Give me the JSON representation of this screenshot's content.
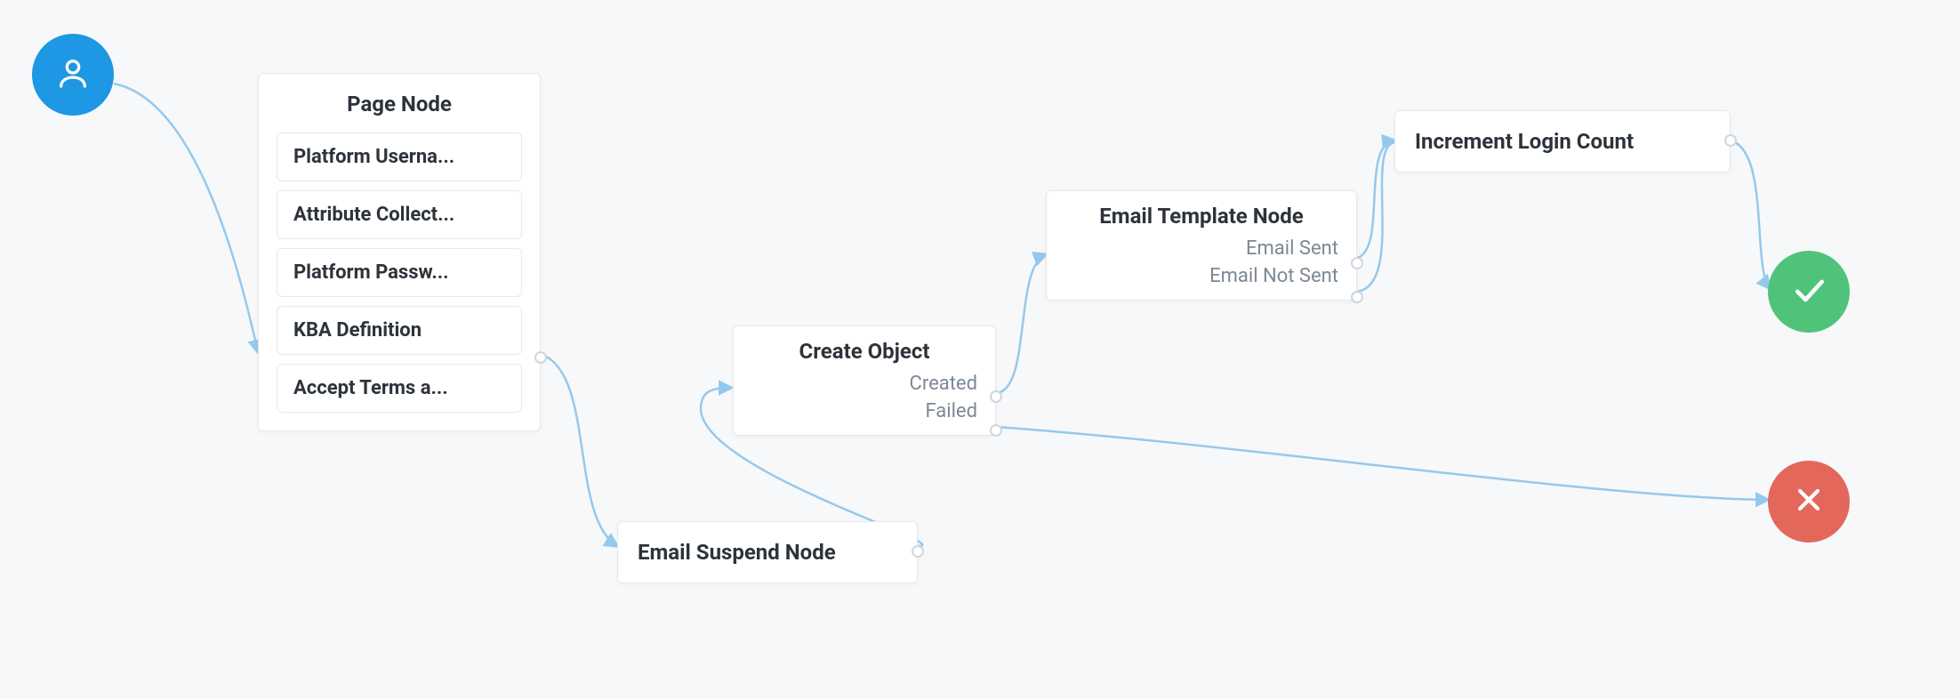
{
  "colors": {
    "start": "#1e97e4",
    "success": "#4fc37a",
    "failure": "#e4675c",
    "connector": "#94c9ed"
  },
  "nodes": {
    "pageNode": {
      "title": "Page Node",
      "items": [
        "Platform Userna...",
        "Attribute Collect...",
        "Platform Passw...",
        "KBA Definition",
        "Accept Terms a..."
      ]
    },
    "emailSuspend": {
      "title": "Email Suspend Node"
    },
    "createObject": {
      "title": "Create Object",
      "outcomes": [
        "Created",
        "Failed"
      ]
    },
    "emailTemplate": {
      "title": "Email Template Node",
      "outcomes": [
        "Email Sent",
        "Email Not Sent"
      ]
    },
    "incrementLogin": {
      "title": "Increment Login Count"
    }
  },
  "endpoints": {
    "start": "user-icon",
    "success": "check-icon",
    "failure": "x-icon"
  }
}
